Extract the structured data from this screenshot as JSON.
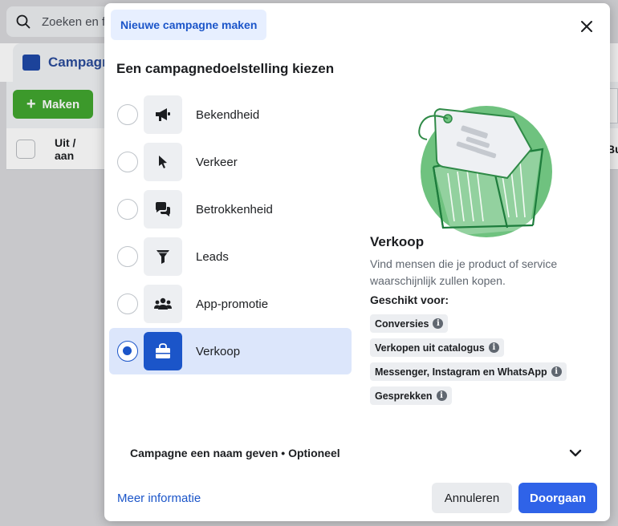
{
  "background": {
    "search_placeholder": "Zoeken en f",
    "tab_label": "Campagn",
    "make_button": "Maken",
    "column_header": "Uit / aan",
    "right_stub": "Bu"
  },
  "modal": {
    "tab_label": "Nieuwe campagne maken",
    "heading": "Een campagnedoelstelling kiezen",
    "objectives": [
      {
        "label": "Bekendheid",
        "icon": "megaphone-icon",
        "selected": false
      },
      {
        "label": "Verkeer",
        "icon": "cursor-icon",
        "selected": false
      },
      {
        "label": "Betrokkenheid",
        "icon": "chat-bubbles-icon",
        "selected": false
      },
      {
        "label": "Leads",
        "icon": "funnel-icon",
        "selected": false
      },
      {
        "label": "App-promotie",
        "icon": "people-icon",
        "selected": false
      },
      {
        "label": "Verkoop",
        "icon": "shopping-bag-icon",
        "selected": true
      }
    ],
    "detail": {
      "title": "Verkoop",
      "description": "Vind mensen die je product of service waarschijnlijk zullen kopen.",
      "suitable_label": "Geschikt voor:",
      "chips": [
        "Conversies",
        "Verkopen uit catalogus",
        "Messenger, Instagram en WhatsApp",
        "Gesprekken"
      ]
    },
    "name_section": "Campagne een naam geven • Optioneel",
    "more_info": "Meer informatie",
    "cancel": "Annuleren",
    "continue": "Doorgaan"
  },
  "colors": {
    "accent_blue": "#2f63e8",
    "selected_bg": "#dce6fb",
    "make_green": "#42a72f",
    "illustration_green": "#6fc27f"
  }
}
